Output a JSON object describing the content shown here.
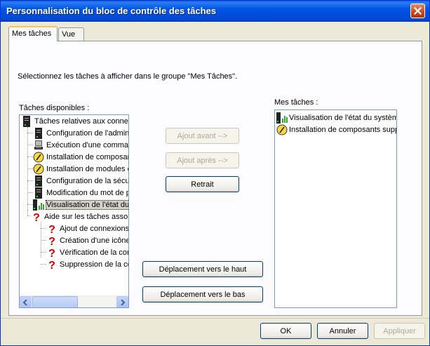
{
  "window": {
    "title": "Personnalisation du bloc de contrôle des tâches"
  },
  "tabs": [
    {
      "label": "Mes tâches",
      "active": true
    },
    {
      "label": "Vue",
      "active": false
    }
  ],
  "instruction": "Sélectionnez les tâches à afficher dans le groupe \"Mes Tâches\".",
  "available": {
    "label": "Tâches disponibles :",
    "tree": [
      {
        "label": "Tâches relatives aux connex",
        "icon": "server-icon"
      },
      {
        "label": "Configuration de l'admini",
        "icon": "server-icon"
      },
      {
        "label": "Exécution d'une comman",
        "icon": "computer-icon"
      },
      {
        "label": "Installation de composar",
        "icon": "install-icon"
      },
      {
        "label": "Installation de modules c",
        "icon": "install-icon"
      },
      {
        "label": "Configuration de la sécu",
        "icon": "server-icon"
      },
      {
        "label": "Modification du mot de p",
        "icon": "server-icon"
      },
      {
        "label": "Visualisation de l'état du",
        "icon": "status-icon"
      },
      {
        "label": "Aide sur les tâches asso",
        "icon": "help-icon"
      },
      {
        "label": "Ajout de connexions",
        "icon": "help-icon"
      },
      {
        "label": "Création d'une icône",
        "icon": "help-icon"
      },
      {
        "label": "Vérification de la cor",
        "icon": "help-icon"
      },
      {
        "label": "Suppression de la co",
        "icon": "help-icon"
      }
    ]
  },
  "mytasks": {
    "label": "Mes tâches :",
    "items": [
      {
        "label": "Visualisation de l'état du système",
        "icon": "status-icon"
      },
      {
        "label": "Installation de composants suppl",
        "icon": "install-icon"
      }
    ]
  },
  "buttons": {
    "add_before": "Ajout avant -->",
    "add_after": "Ajout après -->",
    "remove": "Retrait",
    "move_up": "Déplacement vers le haut",
    "move_down": "Déplacement vers le bas",
    "ok": "OK",
    "cancel": "Annuler",
    "apply": "Appliquer"
  },
  "colors": {
    "title_bar": "#0054e3",
    "selection": "#316ac5",
    "dialog_bg": "#ece9d8"
  }
}
